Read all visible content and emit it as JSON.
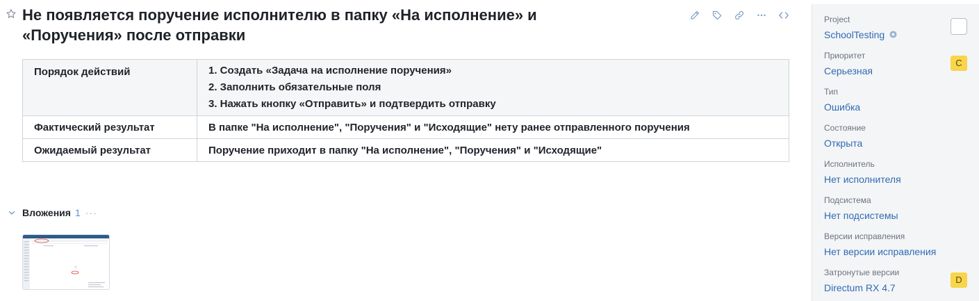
{
  "issue": {
    "title_line1": "Не появляется поручение исполнителю в папку «На исполнение» и",
    "title_line2": "«Поручения» после отправки"
  },
  "toolbar": {
    "icons": [
      "pencil-icon",
      "tag-icon",
      "link-icon",
      "more-icon",
      "code-icon"
    ]
  },
  "details": {
    "rows": [
      {
        "label": "Порядок действий",
        "values": [
          "1. Создать «Задача на исполнение поручения»",
          "2. Заполнить обязательные поля",
          "3. Нажать кнопку «Отправить» и подтвердить отправку"
        ]
      },
      {
        "label": "Фактический результат",
        "values": [
          "В папке \"На исполнение\", \"Поручения\" и \"Исходящие\" нету ранее отправленного поручения"
        ]
      },
      {
        "label": "Ожидаемый результат",
        "values": [
          "Поручение приходит в папку \"На исполнение\", \"Поручения\" и \"Исходящие\""
        ]
      }
    ]
  },
  "attachments": {
    "title": "Вложения",
    "count": "1",
    "more": "···"
  },
  "sidebar": {
    "fields": [
      {
        "label": "Project",
        "value": "SchoolTesting"
      },
      {
        "label": "Приоритет",
        "value": "Серьезная",
        "badge": "C"
      },
      {
        "label": "Тип",
        "value": "Ошибка"
      },
      {
        "label": "Состояние",
        "value": "Открыта"
      },
      {
        "label": "Исполнитель",
        "value": "Нет исполнителя"
      },
      {
        "label": "Подсистема",
        "value": "Нет подсистемы"
      },
      {
        "label": "Версии исправления",
        "value": "Нет версии исправления"
      },
      {
        "label": "Затронутые версии",
        "value": "Directum RX 4.7",
        "badge": "D"
      }
    ]
  },
  "colors": {
    "link": "#2f6bb3",
    "badge": "#f8d54a",
    "table_header_bg": "#f5f6f7",
    "sidebar_bg": "#f4f5f7"
  }
}
